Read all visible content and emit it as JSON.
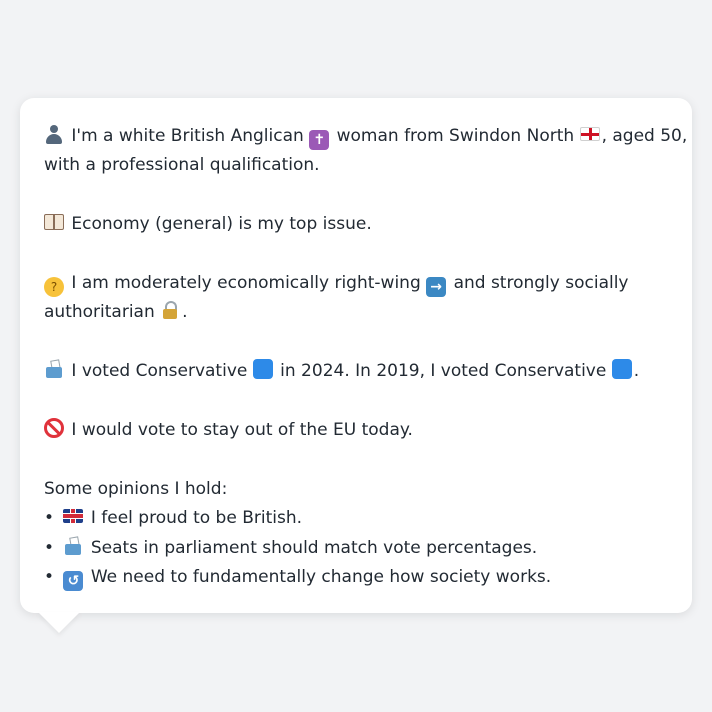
{
  "bubble": {
    "intro": {
      "text_1": "I'm a white British Anglican",
      "text_2": "woman from Swindon North",
      "text_3": ", aged 50,",
      "text_4": "with a professional qualification."
    },
    "top_issue": {
      "text": "Economy (general) is my top issue."
    },
    "ideology": {
      "text_1": "I am moderately economically right-wing",
      "text_2": "and strongly socially",
      "text_3": "authoritarian",
      "text_4": "."
    },
    "votes": {
      "text_1": "I voted Conservative",
      "text_2": "in 2024. In 2019, I voted Conservative",
      "text_3": "."
    },
    "eu": {
      "text": "I would vote to stay out of the EU today."
    },
    "opinions": {
      "heading": "Some opinions I hold:",
      "bullet_char": "•",
      "items": [
        {
          "icon": "flag-uk-icon",
          "text": "I feel proud to be British."
        },
        {
          "icon": "ballot-box-icon",
          "text": "Seats in parliament should match vote percentages."
        },
        {
          "icon": "cycle-arrows-icon",
          "text": "We need to fundamentally change how society works."
        }
      ]
    },
    "icons": {
      "person": "bust-in-silhouette",
      "cross": "latin-cross",
      "england_flag": "england-flag",
      "book": "open-book",
      "thinking": "thinking-face",
      "arrow": "right-arrow",
      "lock": "locked",
      "ballot": "ballot-box",
      "conservative_color": "#2d8ae8",
      "prohibited": "prohibited",
      "uk_flag": "uk-flag",
      "cycle": "anticlockwise-arrows"
    }
  }
}
